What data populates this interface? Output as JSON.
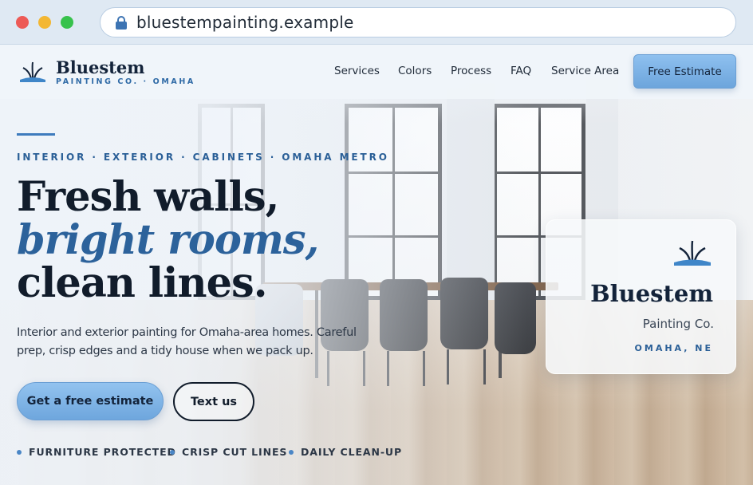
{
  "browser": {
    "url": "bluestempainting.example"
  },
  "brand": {
    "name": "Bluestem",
    "tagline": "PAINTING CO. · OMAHA",
    "accent_color": "#2c629b",
    "button_color": "#7db3e6"
  },
  "nav": {
    "links": [
      "Services",
      "Colors",
      "Process",
      "FAQ",
      "Service Area"
    ],
    "cta_label": "Free Estimate"
  },
  "hero": {
    "eyebrow": "INTERIOR · EXTERIOR · CABINETS · OMAHA METRO",
    "headline_line1": "Fresh walls,",
    "headline_line2": "bright rooms,",
    "headline_line3": "clean lines.",
    "lede": "Interior and exterior painting for Omaha-area homes. Careful prep, crisp edges and a tidy house when we pack up.",
    "primary_cta": "Get a free estimate",
    "secondary_cta": "Text us",
    "features": [
      "FURNITURE PROTECTED",
      "CRISP CUT LINES",
      "DAILY CLEAN-UP"
    ]
  },
  "card": {
    "brand": "Bluestem",
    "subtitle": "Painting Co.",
    "location": "OMAHA, NE"
  },
  "icons": {
    "lock": "lock-icon",
    "logo": "bluestem-grass-logo-icon"
  }
}
